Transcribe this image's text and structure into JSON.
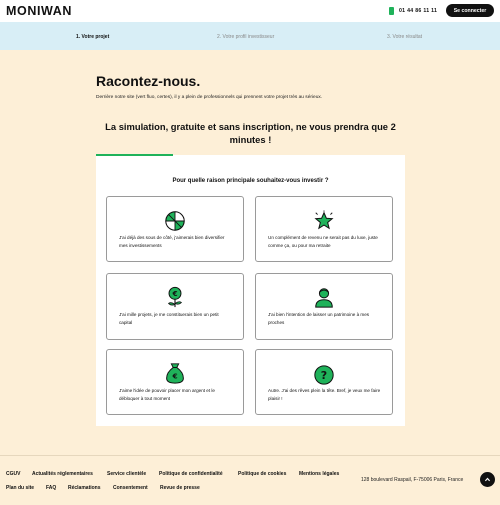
{
  "header": {
    "logo": "MONIWAN",
    "phone": "01 44 86 11 11",
    "login_label": "Se connecter"
  },
  "steps": [
    {
      "label": "1. Votre projet",
      "active": true
    },
    {
      "label": "2. Votre profil investisseur",
      "active": false
    },
    {
      "label": "3. Votre résultat",
      "active": false
    }
  ],
  "main": {
    "title": "Racontez-nous.",
    "intro": "Derrière notre site (vert fluo, certes), il y a plein de professionnels qui prennent votre projet très au sérieux.",
    "headline": "La simulation, gratuite et sans inscription, ne vous prendra que 2 minutes !",
    "progress_fraction": 0.25,
    "question": "Pour quelle raison principale souhaitez-vous investir ?",
    "options": [
      {
        "icon": "diversify-pie-icon",
        "text": "J'ai déjà des sous de côté, j'aimerais bien diversifier mes investissements"
      },
      {
        "icon": "star-income-icon",
        "text": "Un complément de revenu ne serait pas du luxe, juste comme ça, ou pour ma retraite"
      },
      {
        "icon": "euro-plant-icon",
        "text": "J'ai mille projets, je me constituerais bien un petit capital"
      },
      {
        "icon": "heir-person-icon",
        "text": "J'ai bien l'intention de laisser un patrimoine à mes proches"
      },
      {
        "icon": "euro-bag-icon",
        "text": "J'aime l'idée de pouvoir placer mon argent et le débloquer à tout moment"
      },
      {
        "icon": "question-mark-icon",
        "text": "Autre. J'ai des rêves plein la tête. Bref, je veux me faire plaisir !"
      }
    ]
  },
  "footer": {
    "links_row1": [
      "CGUV",
      "Actualités réglementaires",
      "Service clientèle",
      "Politique de confidentialité",
      "Politique de cookies",
      "Mentions légales"
    ],
    "links_row2": [
      "Plan du site",
      "FAQ",
      "Réclamations",
      "Consentement",
      "Revue de presse"
    ],
    "address": "128 boulevard Raspail, F-75006 Paris, France"
  },
  "colors": {
    "accent_green": "#1fb25a",
    "background": "#fdefd7",
    "stepbar": "#d8eef6",
    "dark": "#111111"
  }
}
